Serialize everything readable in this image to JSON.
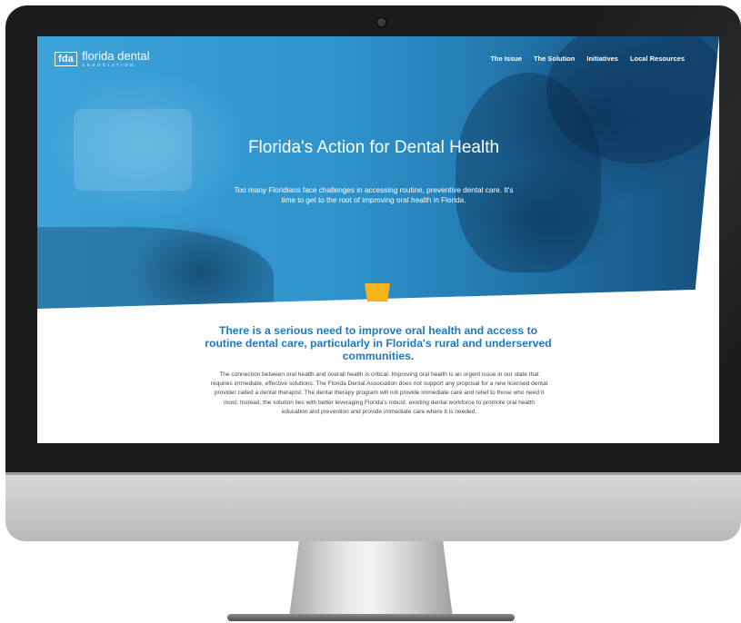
{
  "site": {
    "logo_mark": "fda",
    "logo_name": "florida dental",
    "logo_sub": "ASSOCIATION"
  },
  "nav": {
    "items": [
      "The Issue",
      "The Solution",
      "Initiatives",
      "Local Resources"
    ]
  },
  "hero": {
    "title": "Florida's Action for Dental Health",
    "subtitle": "Too many Floridians face challenges in accessing routine, preventive dental care. It's time to get to the root of improving oral health in Florida."
  },
  "main": {
    "headline": "There is a serious need to improve oral health and access to routine dental care, particularly in Florida's rural and underserved communities.",
    "body": "The connection between oral health and overall health is critical. Improving oral health is an urgent issue in our state that requires immediate, effective solutions. The Florida Dental Association does not support any proposal for a new licensed dental provider called a dental therapist. The dental therapy program will not provide immediate care and relief to those who need it most. Instead, the solution lies with better leveraging Florida's robust, existing dental workforce to promote oral health education and prevention and provide immediate care where it is needed."
  },
  "colors": {
    "hero_blue": "#2f93cc",
    "headline_blue": "#1f78bd",
    "accent_yellow": "#f5b41c",
    "bezel": "#1b1c1e"
  },
  "icons": {
    "tooth": "tooth-icon"
  }
}
